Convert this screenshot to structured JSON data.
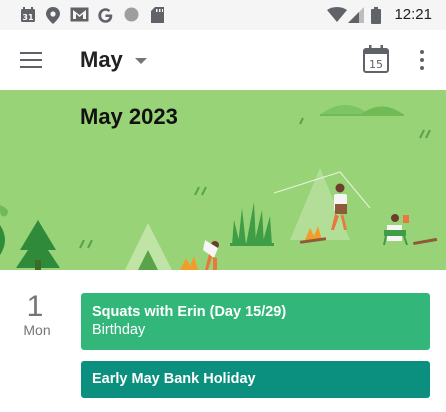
{
  "status_bar": {
    "time": "12:21",
    "left_icons": [
      "calendar-notification-icon",
      "location-icon",
      "gmail-icon",
      "google-icon",
      "circle-notification-icon",
      "sd-card-icon"
    ],
    "right_icons": [
      "wifi-icon",
      "cellular-signal-icon",
      "battery-icon"
    ]
  },
  "app_bar": {
    "month_label": "May",
    "today_date": "15",
    "icons": [
      "menu-icon",
      "dropdown-caret-icon",
      "today-calendar-icon",
      "more-vert-icon"
    ]
  },
  "banner": {
    "title": "May 2023"
  },
  "agenda": {
    "day_number": "1",
    "day_name": "Mon",
    "events": [
      {
        "title": "Squats with Erin (Day 15/29)",
        "subtitle": "Birthday",
        "color": "#33b679"
      },
      {
        "title": "Early May Bank Holiday",
        "color": "#0b8f7e"
      }
    ]
  },
  "colors": {
    "banner_background": "#98d378",
    "status_bar_background": "#f5f5f5"
  }
}
